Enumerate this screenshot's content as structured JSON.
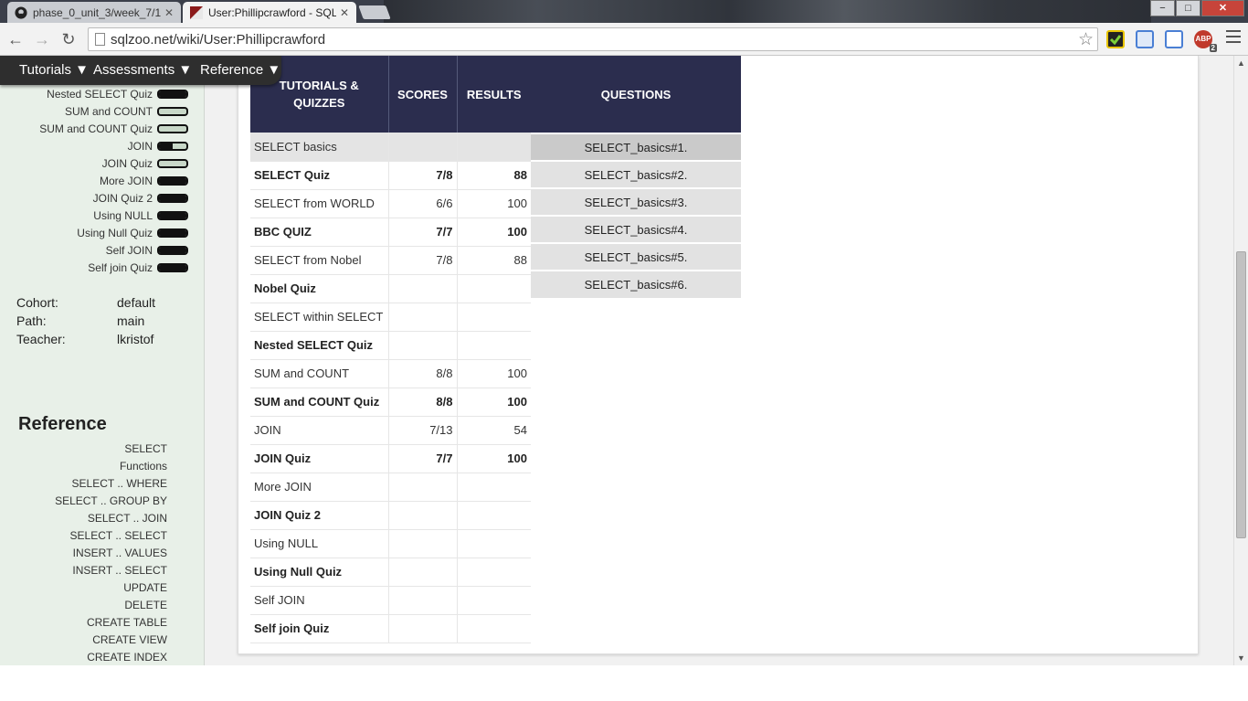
{
  "browser": {
    "tabs": [
      {
        "title": "phase_0_unit_3/week_7/1_",
        "icon": "github-icon",
        "active": false
      },
      {
        "title": "User:Phillipcrawford - SQL",
        "icon": "sqlzoo-icon",
        "active": true
      }
    ],
    "url": "sqlzoo.net/wiki/User:Phillipcrawford",
    "window_buttons": {
      "minimize": "−",
      "maximize": "□",
      "close": "✕"
    },
    "extension_badge": "2"
  },
  "topmenu": {
    "items": [
      {
        "label": "Tutorials ▼"
      },
      {
        "label": "Assessments ▼"
      },
      {
        "label": "Reference ▼"
      }
    ]
  },
  "sidebar": {
    "tutorials": [
      {
        "label": "Nested SELECT Quiz",
        "progress": 1.0
      },
      {
        "label": "SUM and COUNT",
        "progress": 0.0
      },
      {
        "label": "SUM and COUNT Quiz",
        "progress": 0.0
      },
      {
        "label": "JOIN",
        "progress": 0.5
      },
      {
        "label": "JOIN Quiz",
        "progress": 0.0
      },
      {
        "label": "More JOIN",
        "progress": 1.0
      },
      {
        "label": "JOIN Quiz 2",
        "progress": 1.0
      },
      {
        "label": "Using NULL",
        "progress": 1.0
      },
      {
        "label": "Using Null Quiz",
        "progress": 1.0
      },
      {
        "label": "Self JOIN",
        "progress": 1.0
      },
      {
        "label": "Self join Quiz",
        "progress": 1.0
      }
    ],
    "info": [
      {
        "key": "Cohort:",
        "value": "default"
      },
      {
        "key": "Path:",
        "value": "main"
      },
      {
        "key": "Teacher:",
        "value": "lkristof"
      }
    ],
    "reference_heading": "Reference",
    "reference_links": [
      "SELECT",
      "Functions",
      "SELECT .. WHERE",
      "SELECT .. GROUP BY",
      "SELECT .. JOIN",
      "SELECT .. SELECT",
      "INSERT .. VALUES",
      "INSERT .. SELECT",
      "UPDATE",
      "DELETE",
      "CREATE TABLE",
      "CREATE VIEW",
      "CREATE INDEX"
    ]
  },
  "scores": {
    "headers": {
      "tutorials": "TUTORIALS &\nQUIZZES",
      "scores": "SCORES",
      "results": "RESULTS"
    },
    "rows": [
      {
        "name": "SELECT basics",
        "score": "",
        "result": "",
        "bold": false,
        "shaded": true
      },
      {
        "name": "SELECT Quiz",
        "score": "7/8",
        "result": "88",
        "bold": true
      },
      {
        "name": "SELECT from WORLD",
        "score": "6/6",
        "result": "100",
        "bold": false
      },
      {
        "name": "BBC QUIZ",
        "score": "7/7",
        "result": "100",
        "bold": true
      },
      {
        "name": "SELECT from Nobel",
        "score": "7/8",
        "result": "88",
        "bold": false
      },
      {
        "name": "Nobel Quiz",
        "score": "",
        "result": "",
        "bold": true
      },
      {
        "name": "SELECT within SELECT",
        "score": "",
        "result": "",
        "bold": false
      },
      {
        "name": "Nested SELECT Quiz",
        "score": "",
        "result": "",
        "bold": true
      },
      {
        "name": "SUM and COUNT",
        "score": "8/8",
        "result": "100",
        "bold": false
      },
      {
        "name": "SUM and COUNT Quiz",
        "score": "8/8",
        "result": "100",
        "bold": true
      },
      {
        "name": "JOIN",
        "score": "7/13",
        "result": "54",
        "bold": false
      },
      {
        "name": "JOIN Quiz",
        "score": "7/7",
        "result": "100",
        "bold": true
      },
      {
        "name": "More JOIN",
        "score": "",
        "result": "",
        "bold": false
      },
      {
        "name": "JOIN Quiz 2",
        "score": "",
        "result": "",
        "bold": true
      },
      {
        "name": "Using NULL",
        "score": "",
        "result": "",
        "bold": false
      },
      {
        "name": "Using Null Quiz",
        "score": "",
        "result": "",
        "bold": true
      },
      {
        "name": "Self JOIN",
        "score": "",
        "result": "",
        "bold": false
      },
      {
        "name": "Self join Quiz",
        "score": "",
        "result": "",
        "bold": true
      }
    ]
  },
  "questions": {
    "header": "QUESTIONS",
    "items": [
      {
        "label": "SELECT_basics#1.",
        "selected": true
      },
      {
        "label": "SELECT_basics#2.",
        "selected": false
      },
      {
        "label": "SELECT_basics#3.",
        "selected": false
      },
      {
        "label": "SELECT_basics#4.",
        "selected": false
      },
      {
        "label": "SELECT_basics#5.",
        "selected": false
      },
      {
        "label": "SELECT_basics#6.",
        "selected": false
      }
    ]
  },
  "colors": {
    "table_header_bg": "#2b2d4e",
    "sidebar_bg": "#e8f0e8",
    "menu_bg": "#2e2e2e"
  }
}
